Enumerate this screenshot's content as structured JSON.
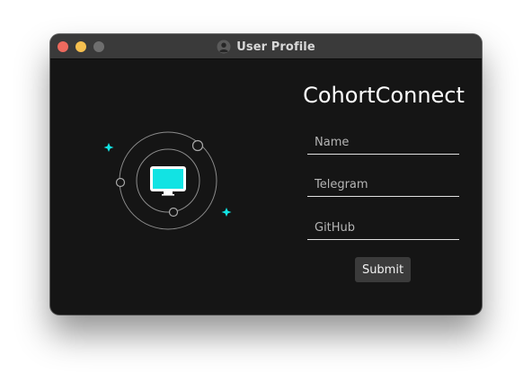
{
  "window": {
    "title": "User Profile",
    "title_icon": "user-avatar-icon",
    "controls": [
      "close",
      "minimize",
      "maximize"
    ]
  },
  "illustration": {
    "icons": [
      "monitor-icon",
      "sparkle-icon",
      "orbit-rings-icon"
    ],
    "accent_color": "#12e3e3"
  },
  "form": {
    "brand": "CohortConnect",
    "name_placeholder": "Name",
    "name_value": "",
    "telegram_placeholder": "Telegram",
    "telegram_value": "",
    "github_placeholder": "GitHub",
    "github_value": "",
    "submit_label": "Submit"
  },
  "colors": {
    "background": "#151515",
    "titlebar": "#3a3a3a",
    "close": "#ed6a5e",
    "minimize": "#f5bf4f",
    "maximize": "#6e6e6e",
    "button": "#3b3b3b"
  }
}
